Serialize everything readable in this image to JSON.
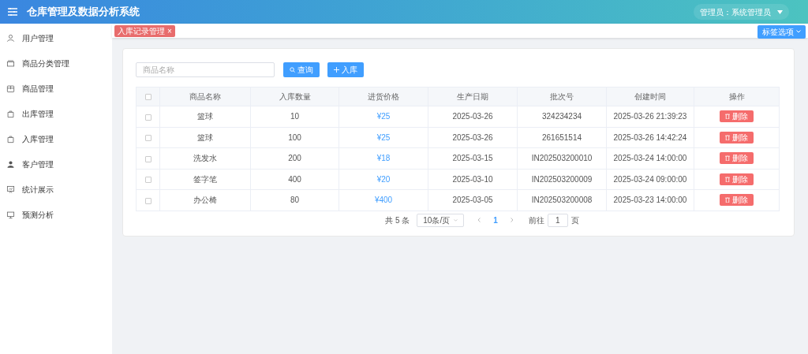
{
  "header": {
    "title": "仓库管理及数据分析系统",
    "user": "管理员：系统管理员"
  },
  "sidebar": {
    "items": [
      {
        "label": "用户管理",
        "selected": false
      },
      {
        "label": "商品分类管理",
        "selected": false
      },
      {
        "label": "商品管理",
        "selected": false
      },
      {
        "label": "出库管理",
        "selected": false
      },
      {
        "label": "入库管理",
        "selected": false
      },
      {
        "label": "客户管理",
        "selected": false
      },
      {
        "label": "统计展示",
        "selected": false
      },
      {
        "label": "预测分析",
        "selected": false
      }
    ]
  },
  "tags": [
    {
      "label": "入库记录管理",
      "selected": true,
      "close": "×"
    }
  ],
  "tag_options": "标签选项",
  "search": {
    "placeholder": "商品名称"
  },
  "buttons": {
    "query": "查询",
    "add": "入库"
  },
  "table": {
    "select_all_checked": false,
    "columns": [
      "商品名称",
      "入库数量",
      "进货价格",
      "生产日期",
      "批次号",
      "创建时间",
      "操作"
    ],
    "rows": [
      {
        "checked": false,
        "cells": [
          "篮球",
          "10",
          "¥25",
          "2025-03-26",
          "324234234",
          "2025-03-26 21:39:23"
        ],
        "action": "删除"
      },
      {
        "checked": false,
        "cells": [
          "篮球",
          "100",
          "¥25",
          "2025-03-26",
          "261651514",
          "2025-03-26 14:42:24"
        ],
        "action": "删除"
      },
      {
        "checked": false,
        "cells": [
          "洗发水",
          "200",
          "¥18",
          "2025-03-15",
          "IN202503200010",
          "2025-03-24 14:00:00"
        ],
        "action": "删除"
      },
      {
        "checked": false,
        "cells": [
          "签字笔",
          "400",
          "¥20",
          "2025-03-10",
          "IN202503200009",
          "2025-03-24 09:00:00"
        ],
        "action": "删除"
      },
      {
        "checked": false,
        "cells": [
          "办公椅",
          "80",
          "¥400",
          "2025-03-05",
          "IN202503200008",
          "2025-03-23 14:00:00"
        ],
        "action": "删除"
      }
    ]
  },
  "pagination": {
    "total": "共 5 条",
    "page_size": "10条/页",
    "pages": [
      {
        "label": "1",
        "selected": true
      }
    ],
    "goto_label": "前往",
    "goto_value": "1",
    "page_unit": "页"
  }
}
